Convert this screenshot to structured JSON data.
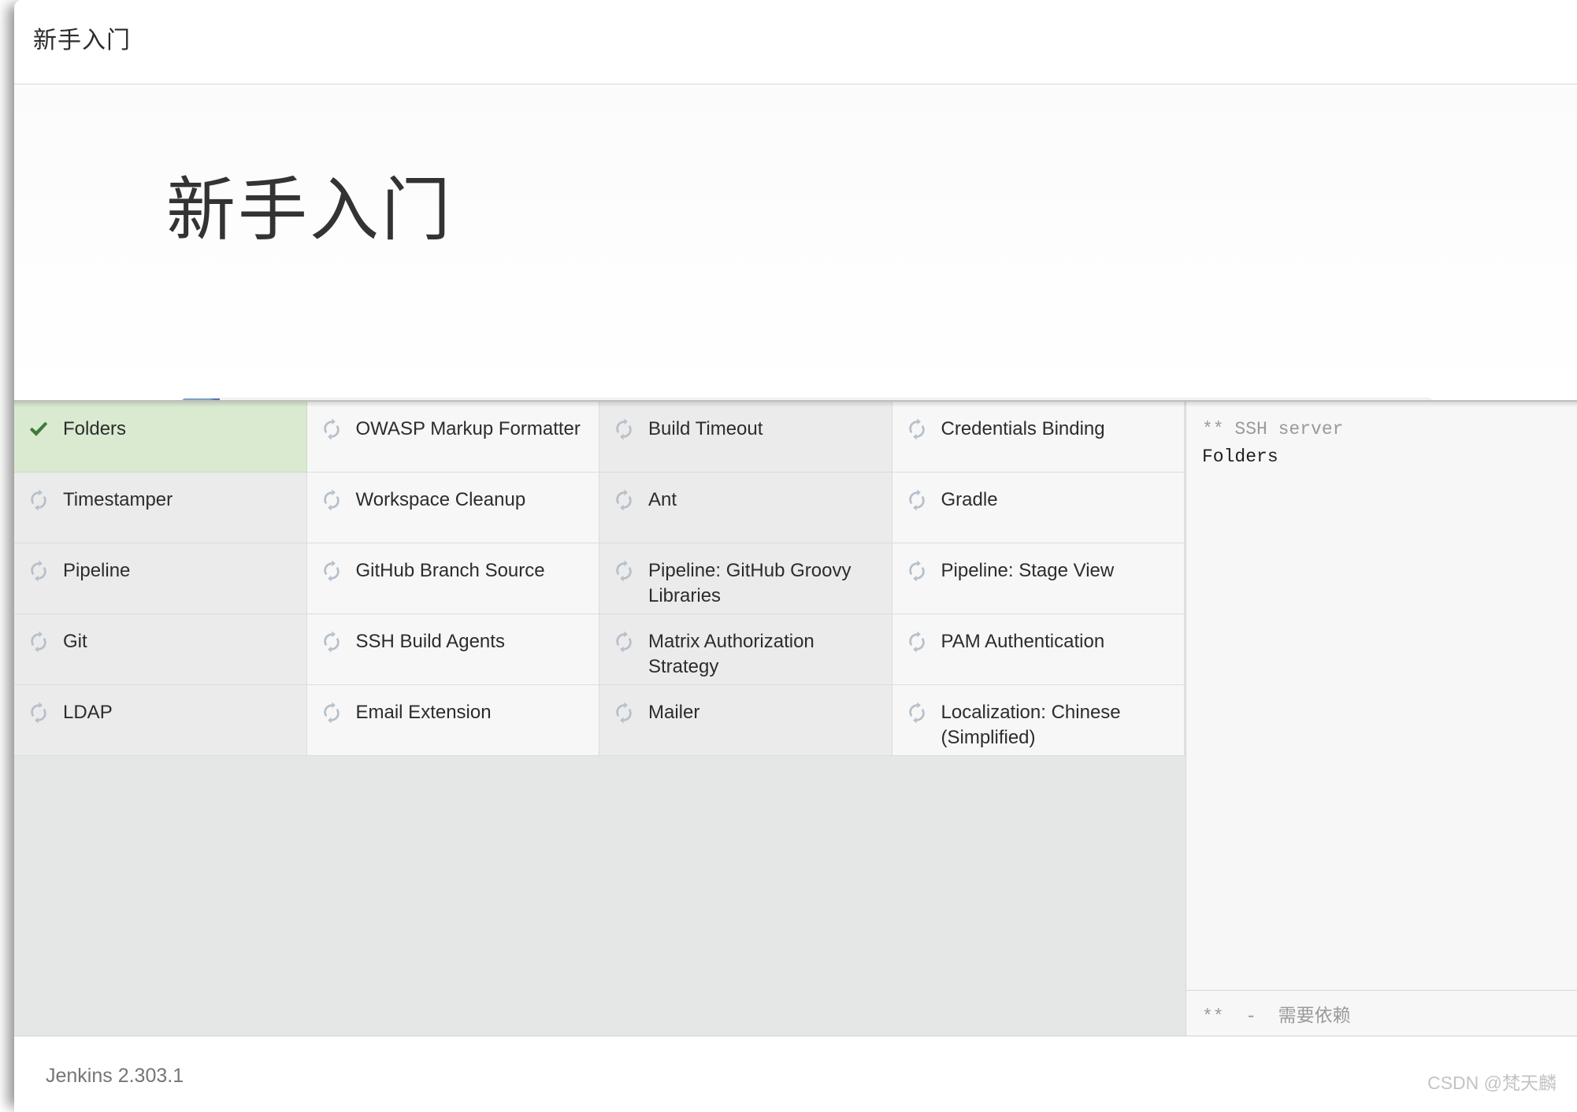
{
  "window": {
    "title": "新手入门"
  },
  "hero": {
    "title": "新手入门",
    "progress_percent": 3
  },
  "plugins": [
    {
      "name": "Folders",
      "status": "done",
      "icon": "check-icon",
      "column": 1,
      "row": 1
    },
    {
      "name": "OWASP Markup Formatter",
      "status": "pending",
      "icon": "sync-icon",
      "column": 2,
      "row": 1
    },
    {
      "name": "Build Timeout",
      "status": "pending",
      "icon": "sync-icon",
      "column": 3,
      "row": 1
    },
    {
      "name": "Credentials Binding",
      "status": "pending",
      "icon": "sync-icon",
      "column": 4,
      "row": 1
    },
    {
      "name": "Timestamper",
      "status": "pending",
      "icon": "sync-icon",
      "column": 1,
      "row": 2
    },
    {
      "name": "Workspace Cleanup",
      "status": "pending",
      "icon": "sync-icon",
      "column": 2,
      "row": 2
    },
    {
      "name": "Ant",
      "status": "pending",
      "icon": "sync-icon",
      "column": 3,
      "row": 2
    },
    {
      "name": "Gradle",
      "status": "pending",
      "icon": "sync-icon",
      "column": 4,
      "row": 2
    },
    {
      "name": "Pipeline",
      "status": "pending",
      "icon": "sync-icon",
      "column": 1,
      "row": 3
    },
    {
      "name": "GitHub Branch Source",
      "status": "pending",
      "icon": "sync-icon",
      "column": 2,
      "row": 3
    },
    {
      "name": "Pipeline: GitHub Groovy Libraries",
      "status": "pending",
      "icon": "sync-icon",
      "column": 3,
      "row": 3
    },
    {
      "name": "Pipeline: Stage View",
      "status": "pending",
      "icon": "sync-icon",
      "column": 4,
      "row": 3
    },
    {
      "name": "Git",
      "status": "pending",
      "icon": "sync-icon",
      "column": 1,
      "row": 4
    },
    {
      "name": "SSH Build Agents",
      "status": "pending",
      "icon": "sync-icon",
      "column": 2,
      "row": 4
    },
    {
      "name": "Matrix Authorization Strategy",
      "status": "pending",
      "icon": "sync-icon",
      "column": 3,
      "row": 4
    },
    {
      "name": "PAM Authentication",
      "status": "pending",
      "icon": "sync-icon",
      "column": 4,
      "row": 4
    },
    {
      "name": "LDAP",
      "status": "pending",
      "icon": "sync-icon",
      "column": 1,
      "row": 5
    },
    {
      "name": "Email Extension",
      "status": "pending",
      "icon": "sync-icon",
      "column": 2,
      "row": 5
    },
    {
      "name": "Mailer",
      "status": "pending",
      "icon": "sync-icon",
      "column": 3,
      "row": 5
    },
    {
      "name": "Localization: Chinese (Simplified)",
      "status": "pending",
      "icon": "sync-icon",
      "column": 4,
      "row": 5
    }
  ],
  "log": {
    "lines": [
      {
        "text": "** SSH server",
        "emphasis": "muted"
      },
      {
        "text": "Folders",
        "emphasis": "strong"
      }
    ],
    "legend": "**  -  需要依赖"
  },
  "footer": {
    "version": "Jenkins 2.303.1",
    "watermark": "CSDN @梵天麟"
  },
  "colors": {
    "progress_fill": "#5a87bf",
    "done_background": "#d9ead0",
    "done_check": "#3f7a3a",
    "pending_icon": "#b6c0cb"
  }
}
